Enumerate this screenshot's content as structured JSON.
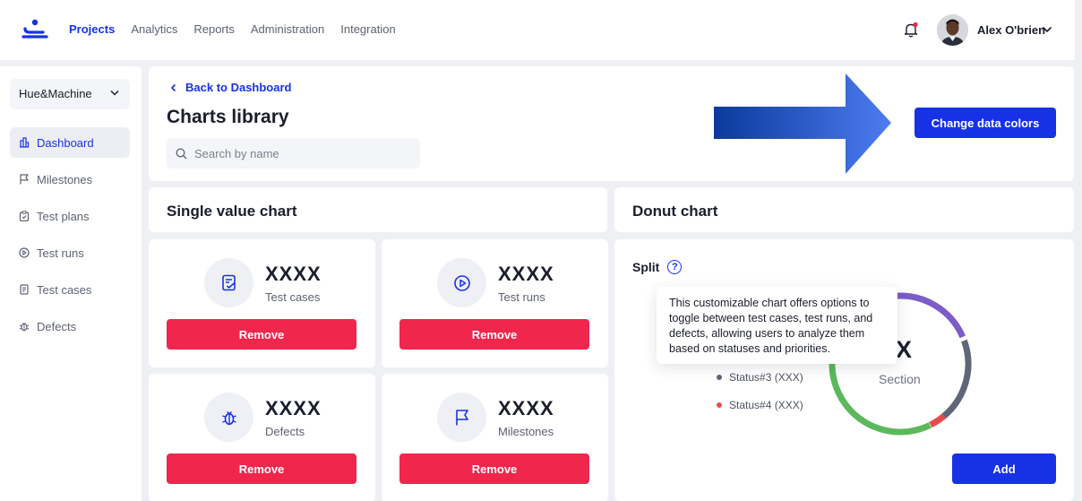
{
  "nav": {
    "items": [
      "Projects",
      "Analytics",
      "Reports",
      "Administration",
      "Integration"
    ],
    "active": "Projects"
  },
  "user": {
    "name": "Alex O'brien"
  },
  "sidebar": {
    "workspace": "Hue&Machine",
    "items": [
      {
        "label": "Dashboard",
        "icon": "dashboard-icon"
      },
      {
        "label": "Milestones",
        "icon": "flag-icon"
      },
      {
        "label": "Test plans",
        "icon": "clipboard-icon"
      },
      {
        "label": "Test runs",
        "icon": "play-icon"
      },
      {
        "label": "Test cases",
        "icon": "document-icon"
      },
      {
        "label": "Defects",
        "icon": "bug-icon"
      }
    ]
  },
  "header": {
    "back_label": "Back to Dashboard",
    "title": "Charts library",
    "search_placeholder": "Search by name",
    "change_colors_label": "Change data colors"
  },
  "single_value": {
    "title": "Single value chart",
    "tiles": [
      {
        "value": "XXXX",
        "label": "Test cases",
        "icon": "test-cases-icon",
        "button": "Remove"
      },
      {
        "value": "XXXX",
        "label": "Test runs",
        "icon": "test-runs-icon",
        "button": "Remove"
      },
      {
        "value": "XXXX",
        "label": "Defects",
        "icon": "bug-icon",
        "button": "Remove"
      },
      {
        "value": "XXXX",
        "label": "Milestones",
        "icon": "flag-icon",
        "button": "Remove"
      }
    ]
  },
  "donut": {
    "title": "Donut chart",
    "split_label": "Split",
    "help_glyph": "?",
    "tooltip": "This customizable chart offers options to toggle between test cases, test runs, and defects, allowing users to analyze them based on statuses and priorities.",
    "center_value": "XX",
    "center_label": "Section",
    "legend": [
      {
        "label": "Status#3 (XXX)",
        "color": "#5f6678"
      },
      {
        "label": "Status#4 (XXX)",
        "color": "#e84b4b"
      }
    ],
    "segment_colors": [
      "#7c5cc9",
      "#5f6678",
      "#e84b4b",
      "#5cb85c"
    ],
    "add_label": "Add"
  },
  "colors": {
    "accent": "#1732e6",
    "danger": "#f0264d"
  }
}
